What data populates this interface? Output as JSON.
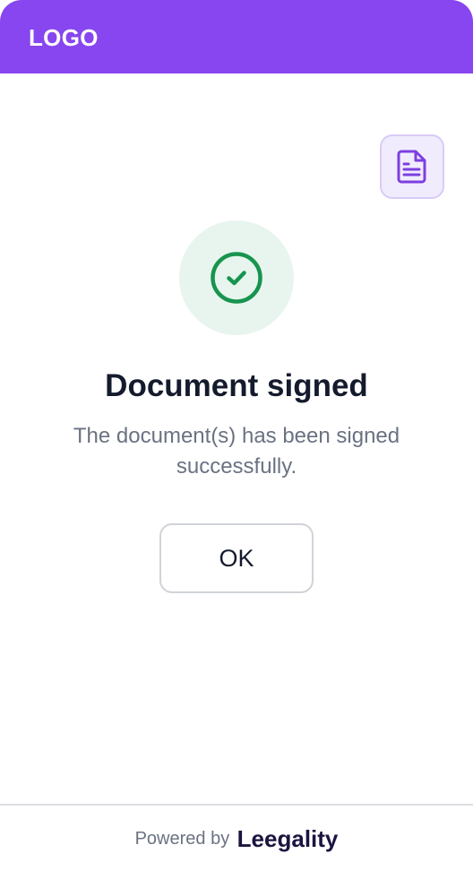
{
  "header": {
    "logo": "LOGO"
  },
  "actions": {
    "document_icon": "document-icon"
  },
  "status": {
    "icon": "check-circle-icon",
    "title": "Document signed",
    "message": "The document(s) has been signed successfully."
  },
  "buttons": {
    "ok_label": "OK"
  },
  "footer": {
    "powered_by": "Powered by",
    "brand": "Leegality"
  },
  "colors": {
    "header_bg": "#8746ef",
    "success": "#17944e",
    "success_bg": "#e8f5ee",
    "doc_icon": "#7d3fe0",
    "doc_button_bg": "#f1ecfd",
    "brand_text": "#1b1440"
  }
}
